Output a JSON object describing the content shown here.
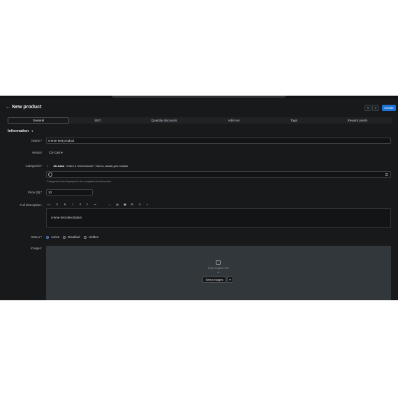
{
  "header": {
    "back_icon": "←",
    "title": "New product",
    "prev_icon": "‹",
    "next_icon": "›",
    "create_label": "Create"
  },
  "tabs": [
    "General",
    "SEO",
    "Quantity discounts",
    "Add-ons",
    "Tags",
    "Reward points"
  ],
  "section": {
    "title": "Information",
    "caret": "▾"
  },
  "form": {
    "name_label": "Name:*",
    "name_value": "creme test product",
    "vendor_label": "Vendor",
    "vendor_value": "CS-Cart ▾",
    "categories_label": "Categories*",
    "category_remove": "×",
    "category_name": "3D-маки",
    "category_path": "Книги и техническое / Пасты, маски для глажки",
    "categories_hint": "Categories to be displayed in the navigation breadcrumbs.",
    "price_label": "Price ($):*",
    "price_value": "10",
    "description_label": "Full description:",
    "toolbar": [
      "<>",
      "¶",
      "B",
      "I",
      "S",
      "≡",
      "≔",
      "—",
      "▤",
      "▣",
      "⊞",
      "⊙",
      "⌕"
    ],
    "description_text": "creme test description",
    "status_label": "Status:*",
    "status_options": [
      "Active",
      "Disabled",
      "Hidden"
    ],
    "images_label": "Images:",
    "drop_text": "Drop images here",
    "or_text": "or",
    "select_images_label": "Select images",
    "select_caret": "▾"
  },
  "colors": {
    "background": "#17191b",
    "accent": "#1d74d6"
  }
}
